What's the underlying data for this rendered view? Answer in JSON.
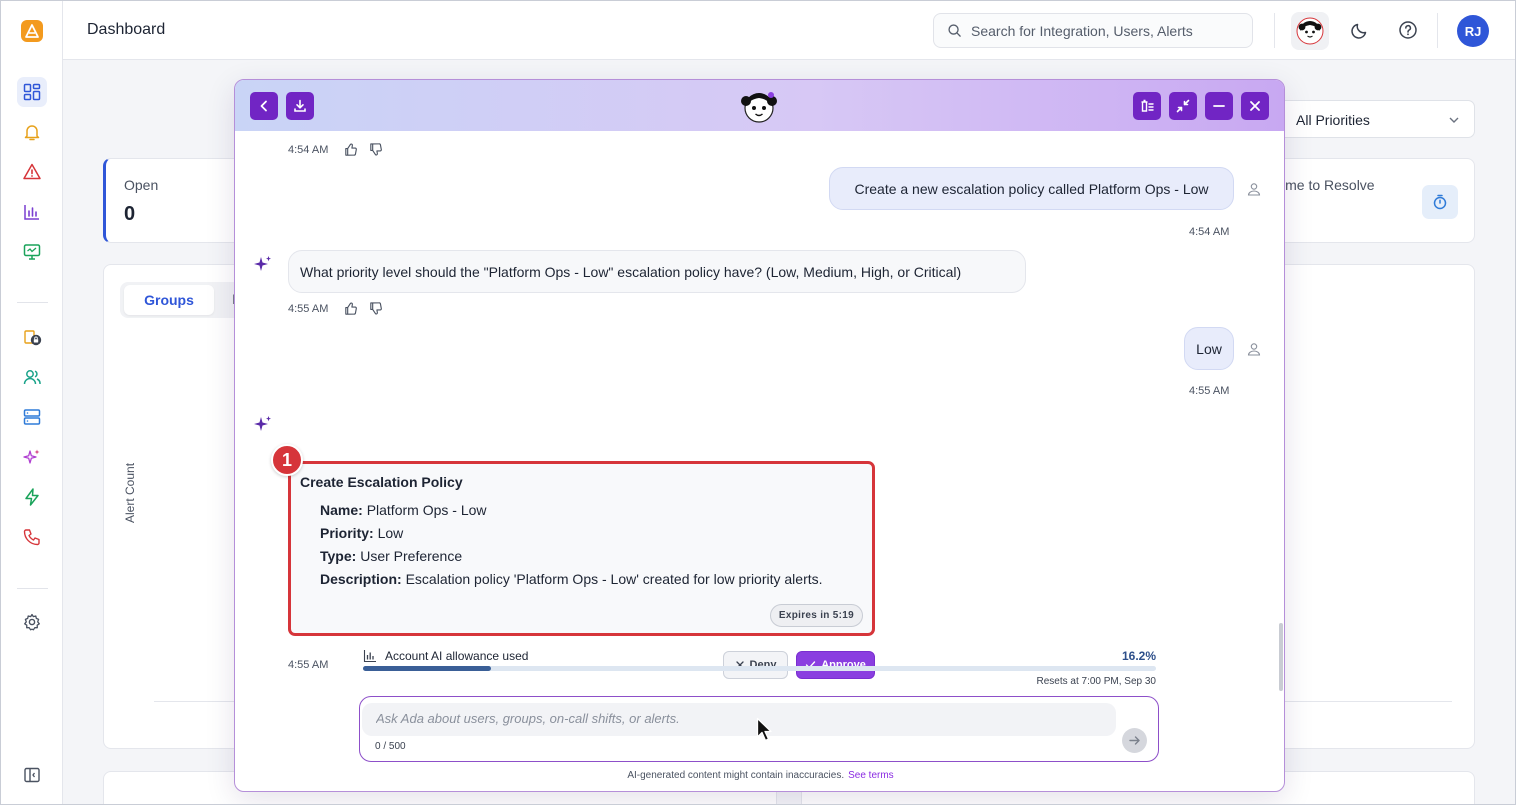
{
  "header": {
    "page_title": "Dashboard",
    "search_placeholder": "Search for Integration, Users, Alerts",
    "avatar_initials": "RJ"
  },
  "sidebar": {
    "items": [
      {
        "name": "dashboard",
        "icon": "grid-icon",
        "active": true
      },
      {
        "name": "alerts",
        "icon": "bell-icon"
      },
      {
        "name": "incidents",
        "icon": "warning-icon"
      },
      {
        "name": "analytics",
        "icon": "bar-chart-icon"
      },
      {
        "name": "monitoring",
        "icon": "monitor-icon"
      },
      {
        "name": "integrations",
        "icon": "lock-book-icon"
      },
      {
        "name": "users",
        "icon": "users-icon"
      },
      {
        "name": "services",
        "icon": "server-icon"
      },
      {
        "name": "ai",
        "icon": "sparkle-icon"
      },
      {
        "name": "automation",
        "icon": "lightning-icon"
      },
      {
        "name": "calls",
        "icon": "phone-icon"
      },
      {
        "name": "settings",
        "icon": "gear-icon"
      },
      {
        "name": "collapse",
        "icon": "sidebar-toggle-icon"
      }
    ]
  },
  "dashboard": {
    "open_label": "Open",
    "open_value": "0",
    "ttr_label": "ime to Resolve",
    "priority_filter": "All Priorities",
    "tab_groups": "Groups",
    "tab_next_partial": "I",
    "y_axis_label": "Alert Count"
  },
  "chat": {
    "messages": [
      {
        "role": "ai",
        "time": "4:54 AM"
      },
      {
        "role": "user",
        "text": "Create a new escalation policy called Platform Ops - Low",
        "time": "4:54 AM"
      },
      {
        "role": "ai",
        "text": "What priority level should the \"Platform Ops - Low\" escalation policy have? (Low, Medium, High, or Critical)",
        "time": "4:55 AM"
      },
      {
        "role": "user",
        "text": "Low",
        "time": "4:55 AM"
      },
      {
        "role": "ai",
        "time": "4:55 AM"
      }
    ],
    "policy": {
      "badge": "1",
      "title": "Create Escalation Policy",
      "name_label": "Name:",
      "name_value": "Platform Ops - Low",
      "priority_label": "Priority:",
      "priority_value": "Low",
      "type_label": "Type:",
      "type_value": "User Preference",
      "description_label": "Description:",
      "description_value": "Escalation policy 'Platform Ops - Low' created for low priority alerts.",
      "expires": "Expires in 5:19"
    },
    "deny_label": "Deny",
    "approve_label": "Approve",
    "allowance": {
      "label": "Account AI allowance used",
      "percent_text": "16.2%",
      "percent": 16.2,
      "reset": "Resets at 7:00 PM, Sep 30"
    },
    "composer": {
      "placeholder": "Ask Ada about users, groups, on-call shifts, or alerts.",
      "count": "0 / 500"
    },
    "disclaimer": "AI-generated content might contain inaccuracies.",
    "terms_link": "See terms"
  },
  "colors": {
    "accent": "#7125c4",
    "approve": "#8a3ee0",
    "highlight": "#d6353a",
    "primary_blue": "#2f56d8"
  }
}
